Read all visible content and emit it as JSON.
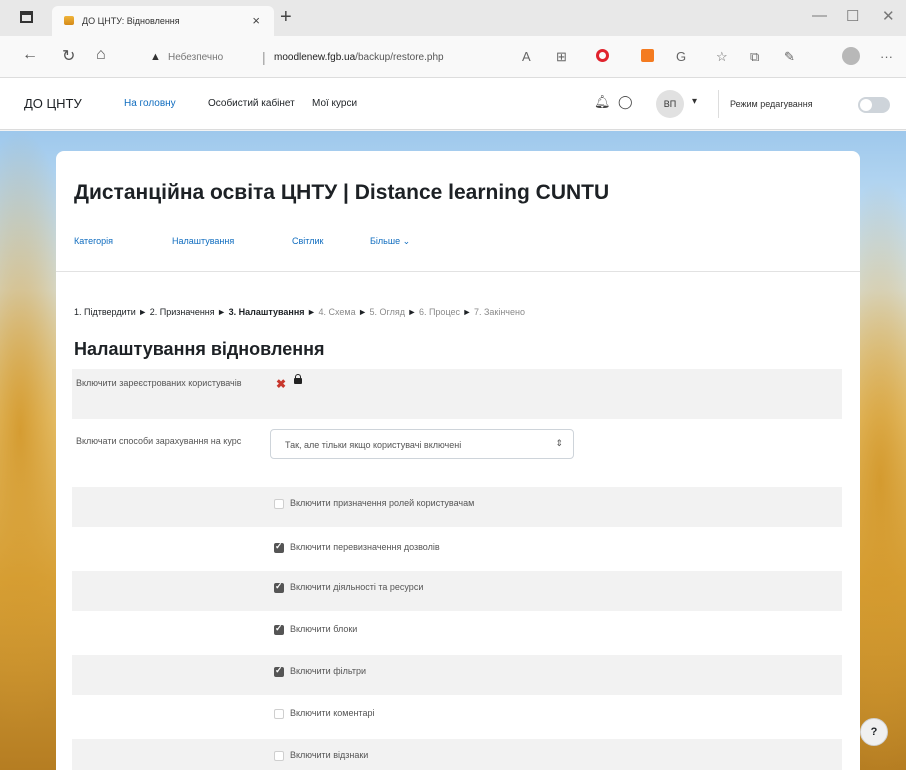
{
  "browser": {
    "tab_title": "ДО ЦНТУ: Відновлення",
    "url_status": "Небезпечно",
    "url_domain": "moodlenew.fgb.ua",
    "url_path": "/backup/restore.php",
    "new_tab_glyph": "+",
    "close_glyph": "×"
  },
  "navbar": {
    "brand": "ДО ЦНТУ",
    "links": [
      "На головну",
      "Особистий кабінет",
      "Мої курси"
    ],
    "avatar_initials": "ВП",
    "edit_mode_label": "Режим редагування"
  },
  "course": {
    "title": "Дистанційна освіта ЦНТУ | Distance learning CUNTU",
    "tabs": [
      "Категорія",
      "Налаштування",
      "Світлик",
      "Більше ⌄"
    ]
  },
  "steps": {
    "items": [
      "1. Підтвердити",
      "2. Призначення",
      "3. Налаштування",
      "4. Схема",
      "5. Огляд",
      "6. Процес",
      "7. Закінчено"
    ],
    "arrow": "►"
  },
  "section": {
    "heading": "Налаштування відновлення"
  },
  "form": {
    "users_label": "Включити зареєстрованих користувачів",
    "users_value": "no",
    "enrol_label": "Включати способи зарахування на курс",
    "enrol_value": "Так, але тільки якщо користувачі включені",
    "checkboxes": [
      {
        "label": "Включити призначення ролей користувачам",
        "checked": false
      },
      {
        "label": "Включити перевизначення дозволів",
        "checked": true
      },
      {
        "label": "Включити діяльності та ресурси",
        "checked": true
      },
      {
        "label": "Включити блоки",
        "checked": true
      },
      {
        "label": "Включити фільтри",
        "checked": true
      },
      {
        "label": "Включити коментарі",
        "checked": false
      },
      {
        "label": "Включити відзнаки",
        "checked": false
      }
    ]
  },
  "help": {
    "label": "?"
  }
}
